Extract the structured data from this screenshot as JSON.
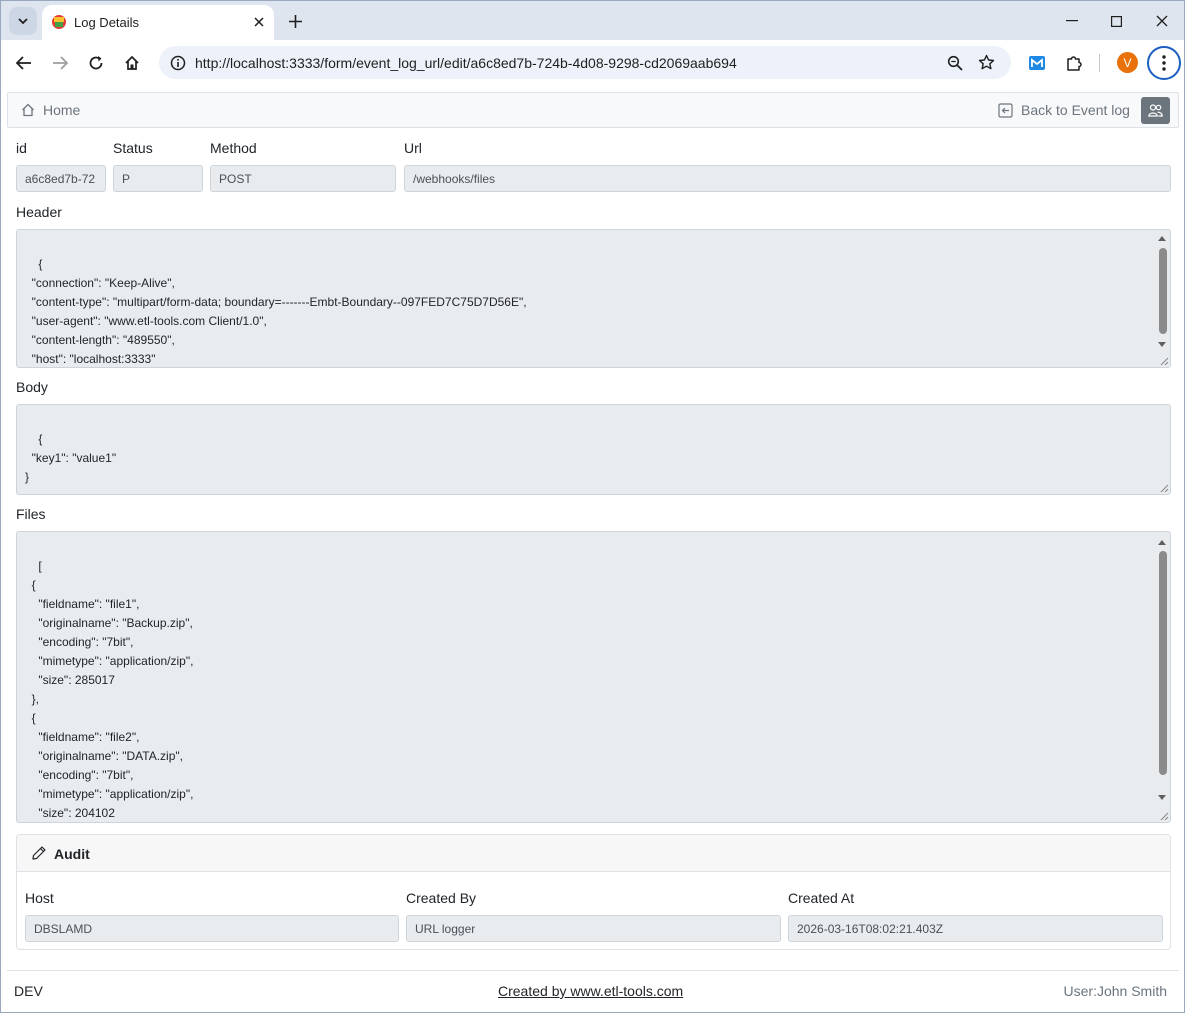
{
  "browser": {
    "tab_title": "Log Details",
    "url": "http://localhost:3333/form/event_log_url/edit/a6c8ed7b-724b-4d08-9298-cd2069aab694",
    "profile_initial": "V",
    "icons": [
      "tab-search-icon",
      "close-icon",
      "plus-icon",
      "minimize-icon",
      "maximize-icon",
      "back-arrow-icon",
      "forward-arrow-icon",
      "reload-icon",
      "home-icon",
      "site-info-icon",
      "zoom-icon",
      "star-icon",
      "extension-m-icon",
      "puzzle-icon",
      "kebab-menu-icon"
    ]
  },
  "nav": {
    "home_label": "Home",
    "back_label": "Back to Event log"
  },
  "form": {
    "id_label": "id",
    "id_value": "a6c8ed7b-72",
    "status_label": "Status",
    "status_value": "P",
    "method_label": "Method",
    "method_value": "POST",
    "url_label": "Url",
    "url_value": "/webhooks/files",
    "header_label": "Header",
    "header_value": "{\n  \"connection\": \"Keep-Alive\",\n  \"content-type\": \"multipart/form-data; boundary=-------Embt-Boundary--097FED7C75D7D56E\",\n  \"user-agent\": \"www.etl-tools.com Client/1.0\",\n  \"content-length\": \"489550\",\n  \"host\": \"localhost:3333\"\n}",
    "body_label": "Body",
    "body_value": "{\n  \"key1\": \"value1\"\n}",
    "files_label": "Files",
    "files_value": "[\n  {\n    \"fieldname\": \"file1\",\n    \"originalname\": \"Backup.zip\",\n    \"encoding\": \"7bit\",\n    \"mimetype\": \"application/zip\",\n    \"size\": 285017\n  },\n  {\n    \"fieldname\": \"file2\",\n    \"originalname\": \"DATA.zip\",\n    \"encoding\": \"7bit\",\n    \"mimetype\": \"application/zip\",\n    \"size\": 204102\n  }"
  },
  "audit": {
    "title": "Audit",
    "host_label": "Host",
    "host_value": "DBSLAMD",
    "created_by_label": "Created By",
    "created_by_value": "URL logger",
    "created_at_label": "Created At",
    "created_at_value": "2026-03-16T08:02:21.403Z"
  },
  "footer": {
    "env": "DEV",
    "link": "Created by www.etl-tools.com",
    "user": "User:John Smith"
  }
}
